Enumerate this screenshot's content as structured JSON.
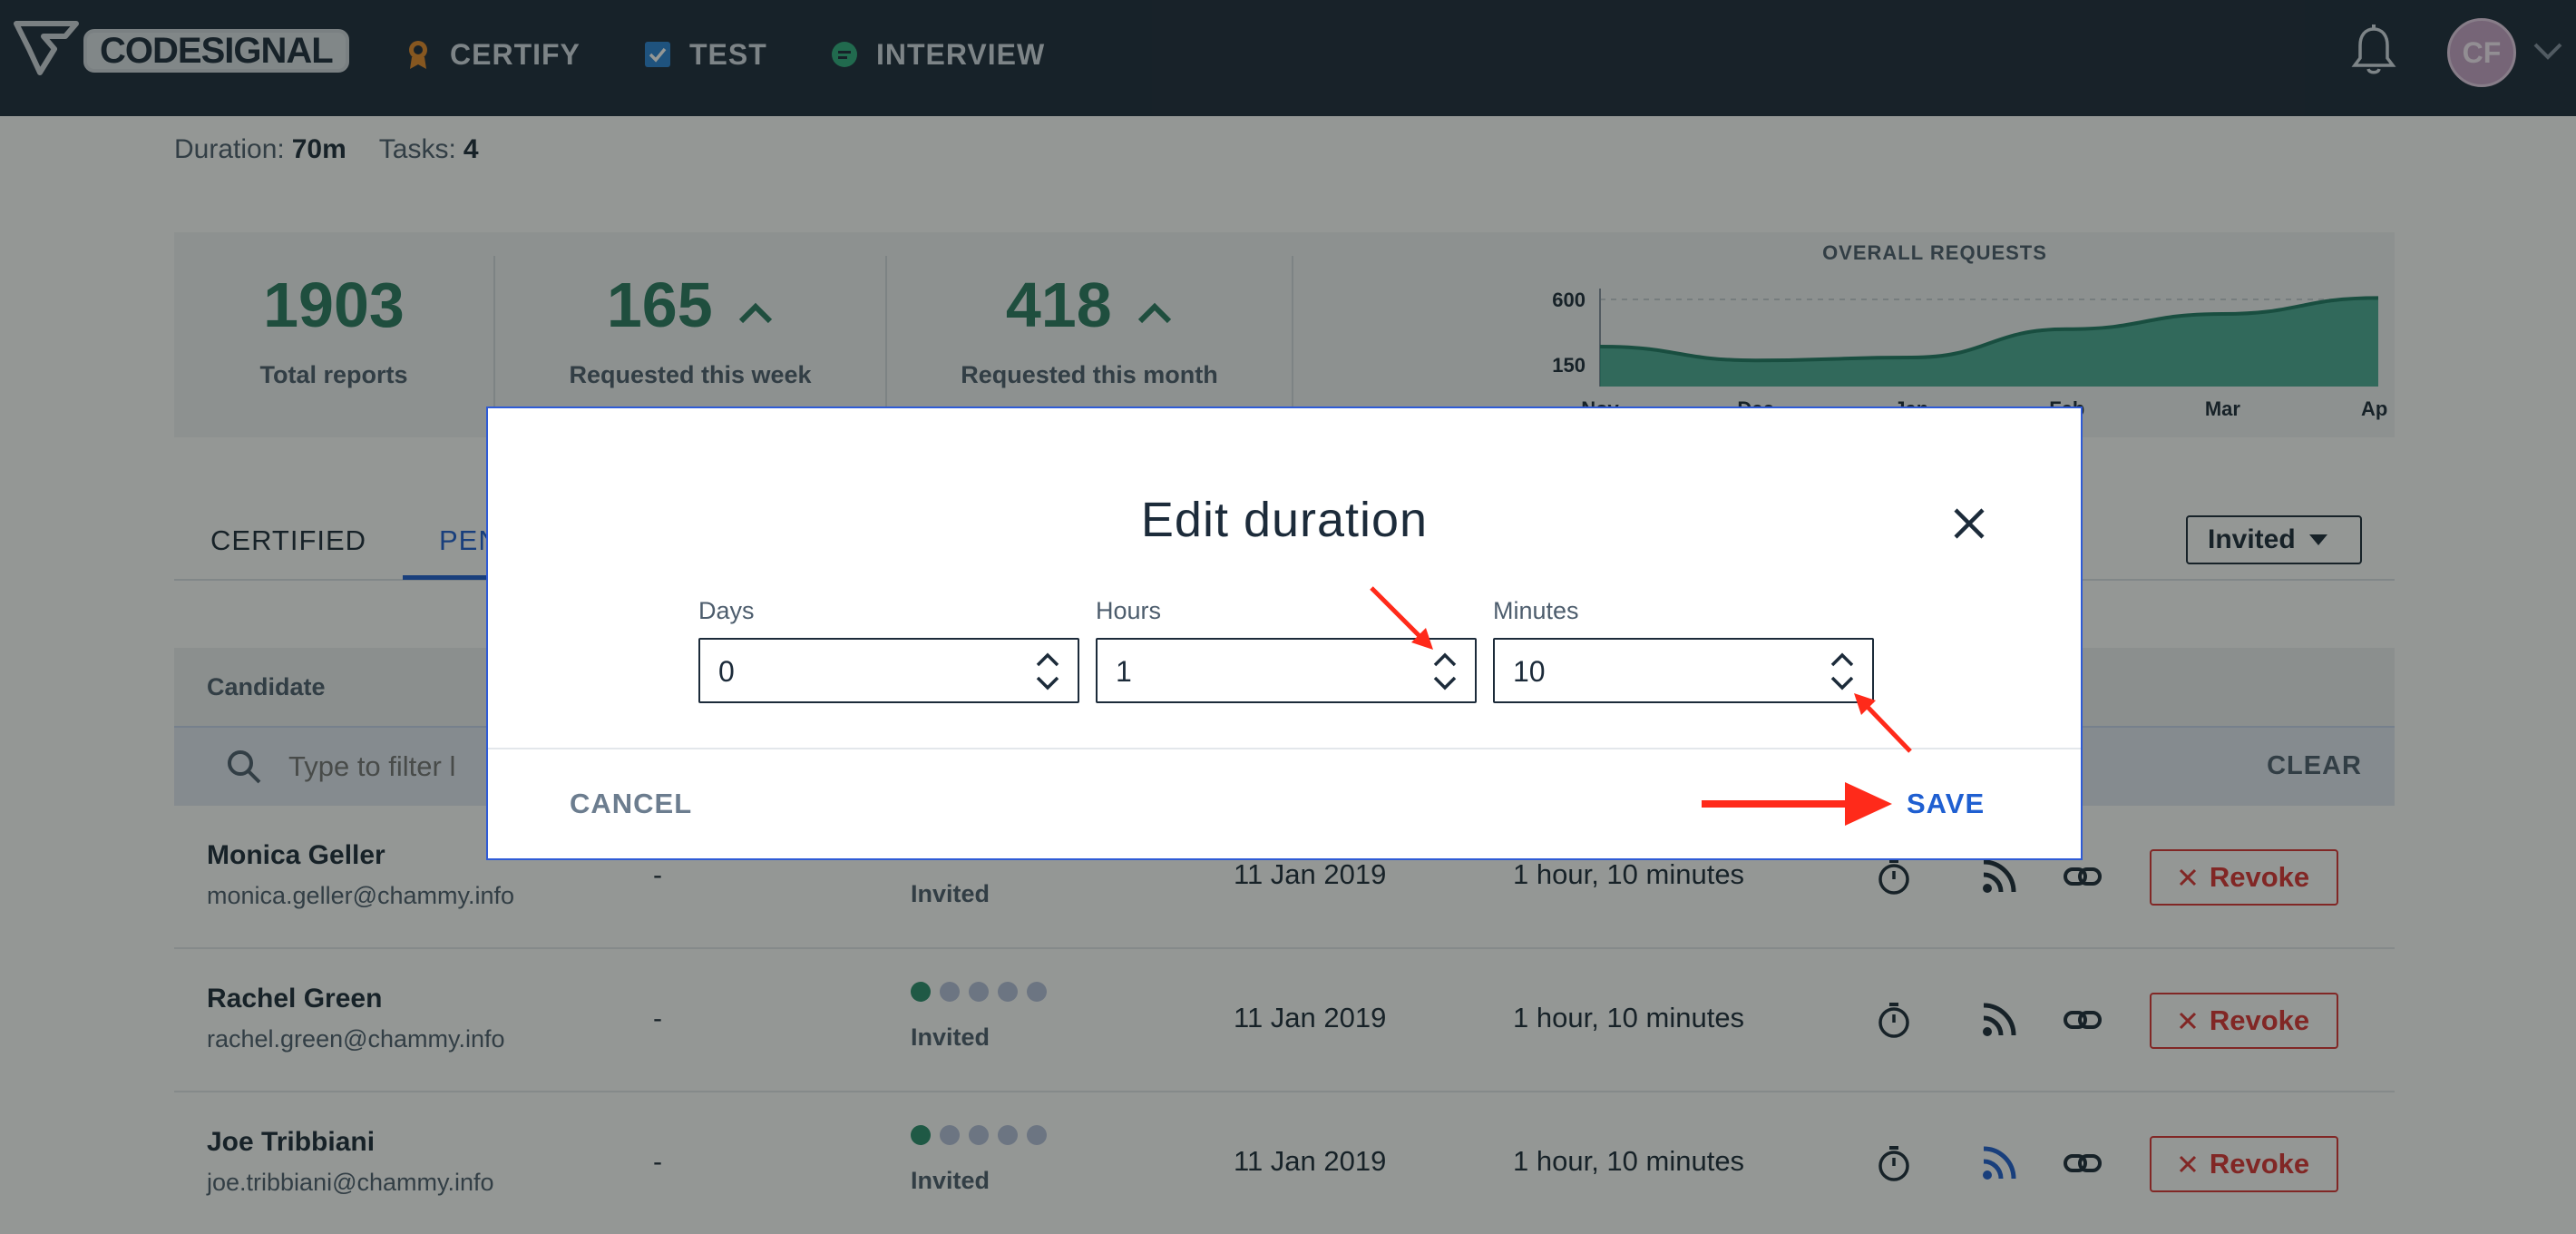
{
  "app": {
    "logo_text": "CODESIGNAL",
    "nav": [
      {
        "label": "CERTIFY",
        "icon": "certify-badge-icon"
      },
      {
        "label": "TEST",
        "icon": "test-checkbox-icon"
      },
      {
        "label": "INTERVIEW",
        "icon": "interview-bubble-icon"
      }
    ],
    "avatar_initials": "CF"
  },
  "meta": {
    "duration_label": "Duration:",
    "duration_value": "70m",
    "tasks_label": "Tasks:",
    "tasks_value": "4"
  },
  "stats": [
    {
      "value": "1903",
      "label": "Total reports",
      "trend": ""
    },
    {
      "value": "165",
      "label": "Requested this week",
      "trend": "up"
    },
    {
      "value": "418",
      "label": "Requested this month",
      "trend": "up"
    }
  ],
  "chart_data": {
    "type": "area",
    "title": "OVERALL REQUESTS",
    "x_ticks": [
      "Nov",
      "Dec",
      "Jan",
      "Feb",
      "Mar",
      "Apr"
    ],
    "y_ticks": [
      150,
      600
    ],
    "ylim": [
      0,
      650
    ],
    "series": [
      {
        "values": [
          275,
          180,
          200,
          395,
          500,
          610
        ]
      }
    ],
    "colors": {
      "fill": "#2e9e85",
      "line": "#1f7a64"
    }
  },
  "tabs": {
    "items": [
      "CERTIFIED",
      "PEN"
    ],
    "active_index": 1
  },
  "filter_dropdown": {
    "selected": "Invited"
  },
  "table": {
    "header": "Candidate",
    "filter_placeholder": "Type to filter l",
    "clear_label": "CLEAR",
    "rows": [
      {
        "name": "Monica Geller",
        "email": "monica.geller@chammy.info",
        "score": "-",
        "status": "Invited",
        "date": "11 Jan 2019",
        "duration": "1 hour, 10 minutes",
        "progress_steps_done": 1,
        "revoke_label": "Revoke"
      },
      {
        "name": "Rachel Green",
        "email": "rachel.green@chammy.info",
        "score": "-",
        "status": "Invited",
        "date": "11 Jan 2019",
        "duration": "1 hour, 10 minutes",
        "progress_steps_done": 1,
        "revoke_label": "Revoke"
      },
      {
        "name": "Joe Tribbiani",
        "email": "joe.tribbiani@chammy.info",
        "score": "-",
        "status": "Invited",
        "date": "11 Jan 2019",
        "duration": "1 hour, 10 minutes",
        "progress_steps_done": 1,
        "revoke_label": "Revoke"
      }
    ]
  },
  "modal": {
    "title": "Edit duration",
    "fields": [
      {
        "label": "Days",
        "value": "0"
      },
      {
        "label": "Hours",
        "value": "1"
      },
      {
        "label": "Minutes",
        "value": "10"
      }
    ],
    "cancel_label": "CANCEL",
    "save_label": "SAVE"
  },
  "colors": {
    "topbar": "#1d2a3b",
    "accent_blue": "#1f5fd1",
    "stat_green": "#2a7b62",
    "revoke_red": "#dd3333",
    "annotation_red": "#ff2a1a"
  }
}
